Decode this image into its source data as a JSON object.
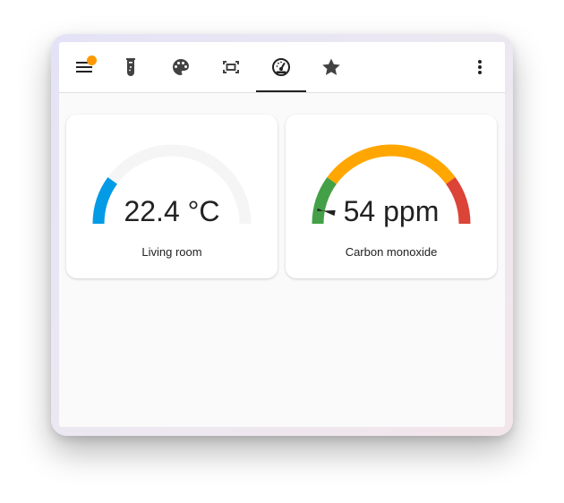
{
  "toolbar": {
    "tabs": [
      {
        "icon": "menu-icon",
        "has_badge": true
      },
      {
        "icon": "test-tube-icon"
      },
      {
        "icon": "palette-icon"
      },
      {
        "icon": "fullscreen-icon"
      },
      {
        "icon": "gauge-icon",
        "selected": true
      },
      {
        "icon": "star-icon"
      }
    ],
    "overflow_icon": "dots-vertical-icon",
    "badge_color": "#ff9800"
  },
  "cards": [
    {
      "value_text": "22.4 °C",
      "label": "Living room",
      "fill_fraction": 0.2,
      "fill_color": "#039be5",
      "track_color": "#f5f5f5"
    },
    {
      "value_text": "54 ppm",
      "label": "Carbon monoxide",
      "needle_fraction": 0.06,
      "segments": [
        {
          "from": 0.0,
          "to": 0.2,
          "color": "#43a047"
        },
        {
          "from": 0.2,
          "to": 0.8,
          "color": "#ffa600"
        },
        {
          "from": 0.8,
          "to": 1.0,
          "color": "#db4437"
        }
      ],
      "needle_color": "#212121"
    }
  ]
}
